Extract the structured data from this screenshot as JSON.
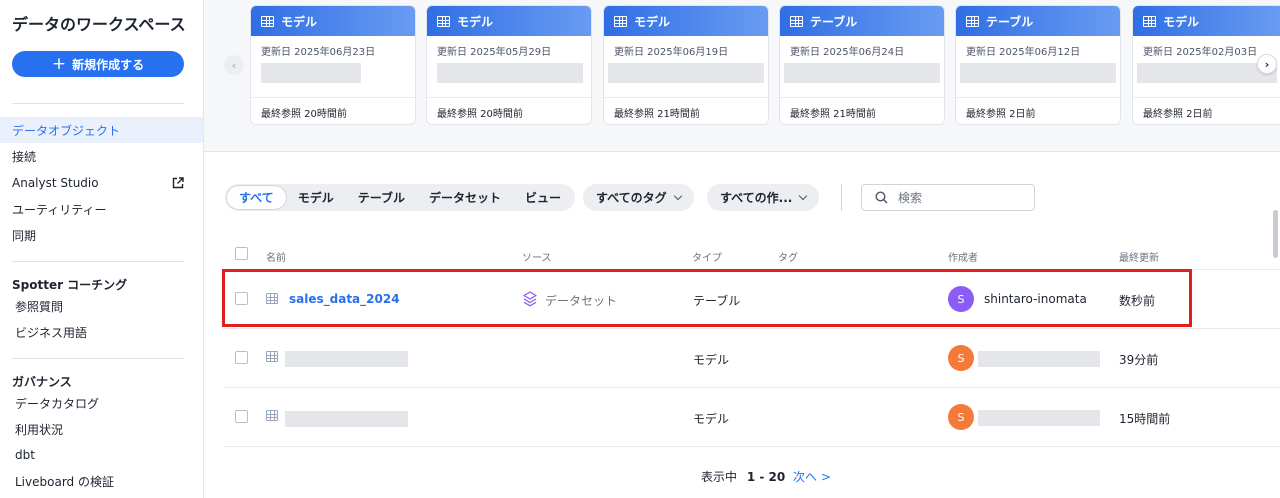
{
  "sidebar": {
    "title": "データのワークスペース",
    "new_button": "新規作成する",
    "nav": {
      "data_objects": "データオブジェクト",
      "connections": "接続",
      "analyst_studio": "Analyst Studio",
      "utilities": "ユーティリティー",
      "sync": "同期"
    },
    "spotter": {
      "heading": "Spotter コーチング",
      "reference_questions": "参照質問",
      "business_terms": "ビジネス用語"
    },
    "governance": {
      "heading": "ガバナンス",
      "data_catalog": "データカタログ",
      "usage": "利用状況",
      "dbt": "dbt",
      "liveboard_verify": "Liveboard の検証"
    }
  },
  "cards": [
    {
      "type": "モデル",
      "date": "更新日 2025年06月23日",
      "last_ref": "最終参照 20時間前"
    },
    {
      "type": "モデル",
      "date": "更新日 2025年05月29日",
      "last_ref": "最終参照 20時間前"
    },
    {
      "type": "モデル",
      "date": "更新日 2025年06月19日",
      "last_ref": "最終参照 21時間前"
    },
    {
      "type": "テーブル",
      "date": "更新日 2025年06月24日",
      "last_ref": "最終参照 21時間前"
    },
    {
      "type": "テーブル",
      "date": "更新日 2025年06月12日",
      "last_ref": "最終参照 2日前"
    },
    {
      "type": "モデル",
      "date": "更新日 2025年02月03日",
      "last_ref": "最終参照 2日前"
    }
  ],
  "filters": {
    "tabs": [
      "すべて",
      "モデル",
      "テーブル",
      "データセット",
      "ビュー"
    ],
    "tags": "すべてのタグ",
    "authors": "すべての作...",
    "search_placeholder": "検索"
  },
  "table": {
    "headers": {
      "name": "名前",
      "source": "ソース",
      "type": "タイプ",
      "tag": "タグ",
      "author": "作成者",
      "updated": "最終更新"
    },
    "rows": [
      {
        "name": "sales_data_2024",
        "source": "データセット",
        "type": "テーブル",
        "avatar": "S",
        "author": "shintaro-inomata",
        "updated": "数秒前"
      },
      {
        "name": "",
        "source": "",
        "type": "モデル",
        "avatar": "S",
        "author": "",
        "updated": "39分前"
      },
      {
        "name": "",
        "source": "",
        "type": "モデル",
        "avatar": "S",
        "author": "",
        "updated": "15時間前"
      }
    ]
  },
  "pager": {
    "label": "表示中",
    "range": "1 - 20",
    "next": "次へ >"
  },
  "colors": {
    "accent": "#2770ef",
    "avatar_purple": "#8b5cf6",
    "avatar_orange": "#f47a3a",
    "highlight": "#e01f1f"
  },
  "icons": {
    "grid": "table-grid-icon",
    "external": "external-link-icon",
    "dataset": "layers-icon",
    "search": "search-icon"
  }
}
